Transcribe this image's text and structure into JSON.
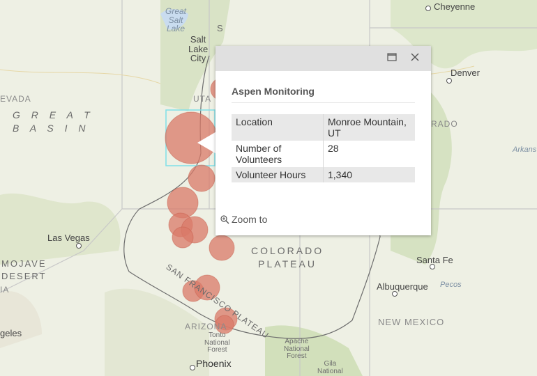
{
  "map": {
    "labels": {
      "cheyenne": "Cheyenne",
      "great_salt_lake": "Great\nSalt\nLake",
      "salt_lake_city": "Salt\nLake\nCity",
      "denver": "Denver",
      "nevada_partial": "EVADA",
      "great_basin": "G R E A T\nB A S I N",
      "utah_partial": "UTA",
      "colorado_partial": "RADO",
      "arkansas_partial": "Arkans",
      "las_vegas": "Las Vegas",
      "mojave_desert": "MOJAVE\nDESERT",
      "colorado_plateau": "COLORADO\nPLATEAU",
      "santa_fe": "Santa Fe",
      "albuquerque": "Albuquerque",
      "pecos": "Pecos",
      "new_mexico": "NEW MEXICO",
      "san_francisco_plateau": "SAN FRANCISCO PLATEAU",
      "arizona": "ARIZONA",
      "tonto": "Tonto\nNational\nForest",
      "apache": "Apache\nNational\nForest",
      "gila": "Gila\nNational",
      "phoenix": "Phoenix",
      "los_angeles_partial": "geles",
      "ia_partial": "IA",
      "s_partial": "S"
    },
    "marker_color": "#d97a68",
    "selection_color": "#7fe0e8"
  },
  "popup": {
    "title": "Aspen Monitoring",
    "rows": [
      {
        "label": "Location",
        "value": "Monroe Mountain, UT"
      },
      {
        "label": "Number of Volunteers",
        "value": "28"
      },
      {
        "label": "Volunteer Hours",
        "value": "1,340"
      }
    ],
    "zoom_label": "Zoom to",
    "icons": {
      "maximize": "maximize-icon",
      "close": "close-icon",
      "zoom": "zoom-in-icon"
    }
  }
}
